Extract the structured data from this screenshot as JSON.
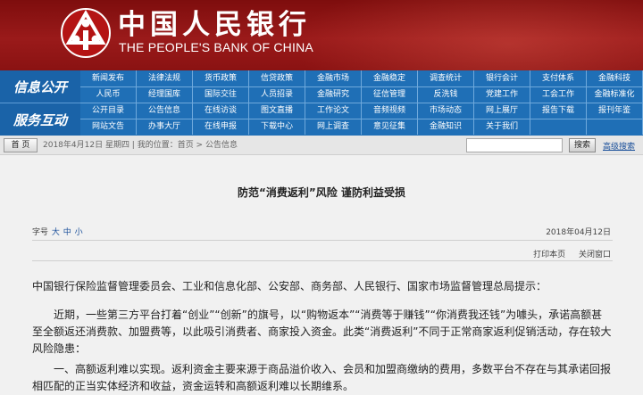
{
  "header": {
    "title_cn": "中国人民银行",
    "title_en": "THE PEOPLE'S BANK OF CHINA",
    "colors": {
      "banner": "#8a1212",
      "nav": "#1f6fb6",
      "link": "#1a4f9a"
    }
  },
  "nav": {
    "section_1": "信息公开",
    "section_2": "服务互动",
    "rows": [
      [
        "新闻发布",
        "法律法规",
        "货币政策",
        "信贷政策",
        "金融市场",
        "金融稳定",
        "调查统计",
        "银行会计",
        "支付体系",
        "金融科技"
      ],
      [
        "人民币",
        "经理国库",
        "国际交往",
        "人员招录",
        "金融研究",
        "征信管理",
        "反洗钱",
        "党建工作",
        "工会工作",
        "金融标准化"
      ],
      [
        "公开目录",
        "公告信息",
        "在线访谈",
        "图文直播",
        "工作论文",
        "音频视频",
        "市场动态",
        "网上展厅",
        "报告下载",
        "报刊年鉴"
      ],
      [
        "网站文告",
        "办事大厅",
        "在线申报",
        "下载中心",
        "网上调查",
        "意见征集",
        "金融知识",
        "关于我们",
        "",
        ""
      ]
    ]
  },
  "breadcrumb": {
    "home_label": "首  页",
    "text": "2018年4月12日 星期四 | 我的位置：首页 > 公告信息",
    "search_button": "搜索",
    "advanced_search": "高级搜索"
  },
  "article": {
    "title": "防范“消费返利”风险 谨防利益受损",
    "font_size_label": "字号",
    "font_sizes": [
      "大",
      "中",
      "小"
    ],
    "date": "2018年04月12日",
    "print_label": "打印本页",
    "close_label": "关闭窗口",
    "paragraphs": [
      "中国银行保险监督管理委员会、工业和信息化部、公安部、商务部、人民银行、国家市场监督管理总局提示：",
      "近期，一些第三方平台打着“创业”“创新”的旗号，以“购物返本”“消费等于赚钱”“你消费我还钱”为噱头，承诺高额甚至全额返还消费款、加盟费等，以此吸引消费者、商家投入资金。此类“消费返利”不同于正常商家返利促销活动，存在较大风险隐患：",
      "一、高额返利难以实现。返利资金主要来源于商品溢价收入、会员和加盟商缴纳的费用，多数平台不存在与其承诺回报相匹配的正当实体经济和收益，资金运转和高额返利难以长期维系。"
    ]
  }
}
